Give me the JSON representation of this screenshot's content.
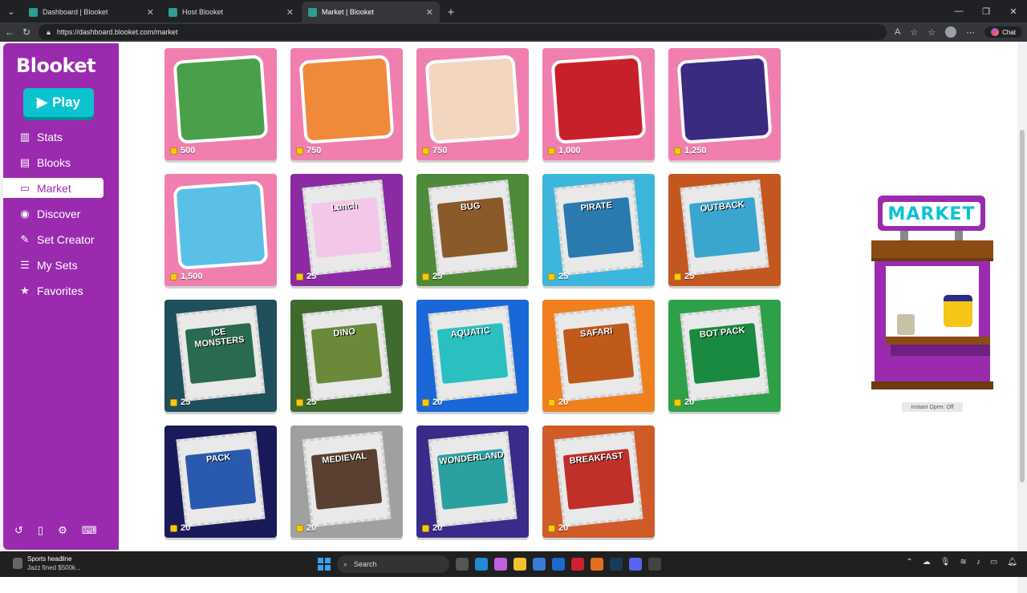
{
  "browser": {
    "tabs": [
      {
        "label": "Dashboard | Blooket",
        "active": false
      },
      {
        "label": "Host Blooket",
        "active": false
      },
      {
        "label": "Market | Blooket",
        "active": true
      }
    ],
    "url": "https://dashboard.blooket.com/market",
    "chat_label": "Chat"
  },
  "sidebar": {
    "logo": "Blooket",
    "play_label": "Play",
    "items": [
      {
        "label": "Stats",
        "icon": "bar-chart-icon",
        "glyph": "▥"
      },
      {
        "label": "Blooks",
        "icon": "briefcase-icon",
        "glyph": "▤"
      },
      {
        "label": "Market",
        "icon": "store-icon",
        "glyph": "▭",
        "active": true
      },
      {
        "label": "Discover",
        "icon": "compass-icon",
        "glyph": "◉"
      },
      {
        "label": "Set Creator",
        "icon": "pencil-icon",
        "glyph": "✎"
      },
      {
        "label": "My Sets",
        "icon": "list-icon",
        "glyph": "☰"
      },
      {
        "label": "Favorites",
        "icon": "star-icon",
        "glyph": "★"
      }
    ],
    "footer_icons": [
      "history-icon",
      "document-icon",
      "gear-icon",
      "keyboard-icon"
    ]
  },
  "market": {
    "items": [
      {
        "name": "",
        "price": "500",
        "kind": "box",
        "bg": "#f07fb0",
        "art": "#4aa04a"
      },
      {
        "name": "",
        "price": "750",
        "kind": "box",
        "bg": "#f07fb0",
        "art": "#f08a3a"
      },
      {
        "name": "",
        "price": "750",
        "kind": "box",
        "bg": "#f07fb0",
        "art": "#f3d6c0"
      },
      {
        "name": "",
        "price": "1,000",
        "kind": "box",
        "bg": "#f07fb0",
        "art": "#c8202a"
      },
      {
        "name": "",
        "price": "1,250",
        "kind": "box",
        "bg": "#f07fb0",
        "art": "#3a2a80"
      },
      {
        "name": "",
        "price": "1,500",
        "kind": "box",
        "bg": "#f07fb0",
        "art": "#5ac0e8"
      },
      {
        "name": "Lunch",
        "price": "25",
        "kind": "pack",
        "bg": "#8b2aa3",
        "art": "#f2c7e8"
      },
      {
        "name": "BUG",
        "price": "25",
        "kind": "pack",
        "bg": "#4e8a3a",
        "art": "#8a5a2a"
      },
      {
        "name": "PIRATE",
        "price": "25",
        "kind": "pack",
        "bg": "#3cb6dc",
        "art": "#2a7ab0"
      },
      {
        "name": "OUTBACK",
        "price": "25",
        "kind": "pack",
        "bg": "#c4571f",
        "art": "#3aa6d0"
      },
      {
        "name": "ICE MONSTERS",
        "price": "25",
        "kind": "pack",
        "bg": "#1f4f5a",
        "art": "#2a6a50"
      },
      {
        "name": "DINO",
        "price": "25",
        "kind": "pack",
        "bg": "#3e6a2e",
        "art": "#6a8a3a"
      },
      {
        "name": "AQUATIC",
        "price": "20",
        "kind": "pack",
        "bg": "#1a68d8",
        "art": "#2ac0c0"
      },
      {
        "name": "SAFARI",
        "price": "20",
        "kind": "pack",
        "bg": "#f0801e",
        "art": "#c05a1a"
      },
      {
        "name": "BOT PACK",
        "price": "20",
        "kind": "pack",
        "bg": "#2ea04a",
        "art": "#1a8a40"
      },
      {
        "name": "PACK",
        "price": "20",
        "kind": "pack",
        "bg": "#181a5a",
        "art": "#2a5ab0"
      },
      {
        "name": "MEDIEVAL",
        "price": "20",
        "kind": "pack",
        "bg": "#a0a0a0",
        "art": "#5a4030"
      },
      {
        "name": "WONDERLAND",
        "price": "20",
        "kind": "pack",
        "bg": "#3a2a8a",
        "art": "#2aa0a0"
      },
      {
        "name": "BREAKFAST",
        "price": "20",
        "kind": "pack",
        "bg": "#d05a28",
        "art": "#c0302a"
      }
    ]
  },
  "stand": {
    "sign": "MARKET",
    "instant_open": "Instant Open: Off"
  },
  "taskbar": {
    "news_title": "Sports headline",
    "news_sub": "Jazz fined $500k...",
    "search_placeholder": "Search"
  }
}
